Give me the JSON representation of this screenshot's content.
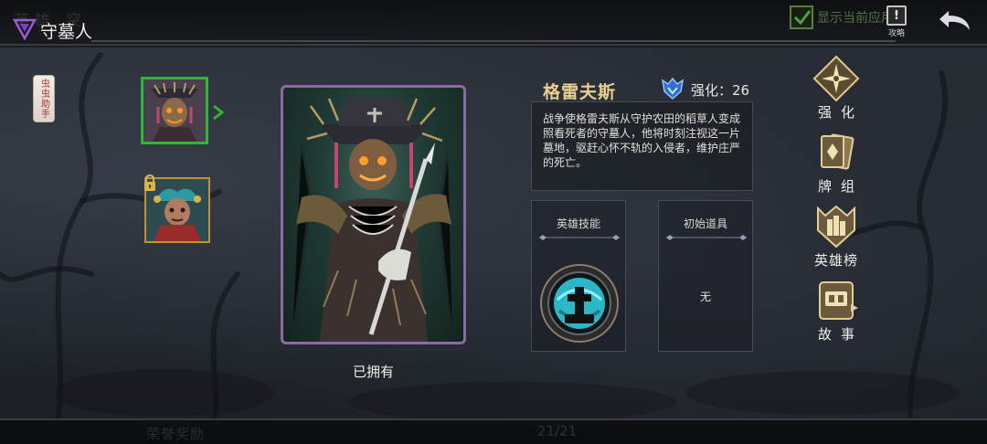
{
  "header": {
    "ghost_title": "英雄  突",
    "title": "守墓人",
    "show_current_label": "显示当前应用",
    "guide_glyph": "!",
    "guide_label": "攻略"
  },
  "sidebar": {
    "assistant_label": "虫虫助手"
  },
  "heroes": [
    {
      "name": "scarecrow-hero",
      "selected": true,
      "locked": false
    },
    {
      "name": "jester-hero",
      "selected": false,
      "locked": true
    }
  ],
  "portrait": {
    "status_label": "已拥有"
  },
  "details": {
    "hero_name": "格雷夫斯",
    "strength_label": "强化：26",
    "description": "战争使格雷夫斯从守护农田的稻草人变成照看死者的守墓人，他将时刻注视这一片墓地，驱赶心怀不轨的入侵者，维护庄严的死亡。",
    "skill_header": "英雄技能",
    "item_header": "初始道具",
    "item_value": "无"
  },
  "menu": [
    {
      "id": "upgrade",
      "label": "强化",
      "icon": "compass-star-icon"
    },
    {
      "id": "deck",
      "label": "牌组",
      "icon": "cards-icon"
    },
    {
      "id": "leaderboard",
      "label": "英雄榜",
      "icon": "shield-emblem-icon"
    },
    {
      "id": "story",
      "label": "故事",
      "icon": "book-icon"
    }
  ],
  "footer": {
    "ghost_left": "荣誉奖励",
    "page_indicator": "21/21"
  },
  "colors": {
    "accent_green": "#31b634",
    "portrait_border": "#8b6aa3",
    "name_gold": "#e8cf92",
    "locked_border": "#c19233"
  }
}
